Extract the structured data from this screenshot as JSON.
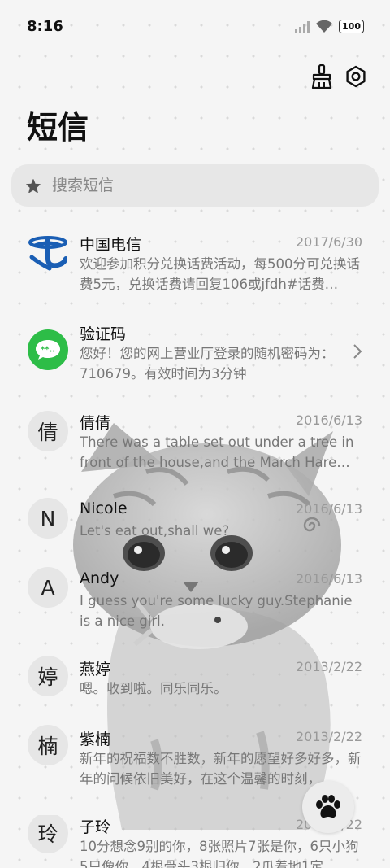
{
  "status": {
    "time": "8:16",
    "battery": "100"
  },
  "header": {
    "title": "短信"
  },
  "search": {
    "placeholder": "搜索短信"
  },
  "conversations": [
    {
      "name": "中国电信",
      "date": "2017/6/30",
      "preview": "欢迎参加积分兑换话费活动，每500分可兑换话费5元，兑换话费请回复106或jfdh#话费…",
      "avatar": "",
      "avatar_icon": "china-telecom-logo"
    },
    {
      "name": "验证码",
      "date": "",
      "preview": "您好！您的网上营业厅登录的随机密码为：710679。有效时间为3分钟",
      "avatar": "",
      "avatar_icon": "verification-code-icon"
    },
    {
      "name": "倩倩",
      "date": "2016/6/13",
      "preview": "There was a table set out under a tree in front of the house,and the March Hare an…",
      "avatar": "倩"
    },
    {
      "name": "Nicole",
      "date": "2016/6/13",
      "preview": "Let's eat out,shall we?",
      "avatar": "N"
    },
    {
      "name": "Andy",
      "date": "2016/6/13",
      "preview": "I guess you're some lucky guy.Stephanie is a nice girl.",
      "avatar": "A"
    },
    {
      "name": "燕婷",
      "date": "2013/2/22",
      "preview": "嗯。收到啦。同乐同乐。",
      "avatar": "婷"
    },
    {
      "name": "紫楠",
      "date": "2013/2/22",
      "preview": "新年的祝福数不胜数，新年的愿望好多好多，新年的问候依旧美好，在这个温馨的时刻，…",
      "avatar": "楠"
    },
    {
      "name": "子玲",
      "date": "2013/2/22",
      "preview": "10分想念9别的你，8张照片7张是你，6只小狗5只像你，4根骨头3根归你，2爪着地1定…",
      "avatar": "玲"
    }
  ],
  "colors": {
    "telecom_blue": "#1a5eb4",
    "verify_green": "#2dbd47",
    "background": "#f5f5f5"
  },
  "icons": {
    "theme": "broom-icon",
    "settings": "settings-hex-icon",
    "search": "star-icon",
    "fab": "paw-icon",
    "chevron": "chevron-right-icon"
  }
}
